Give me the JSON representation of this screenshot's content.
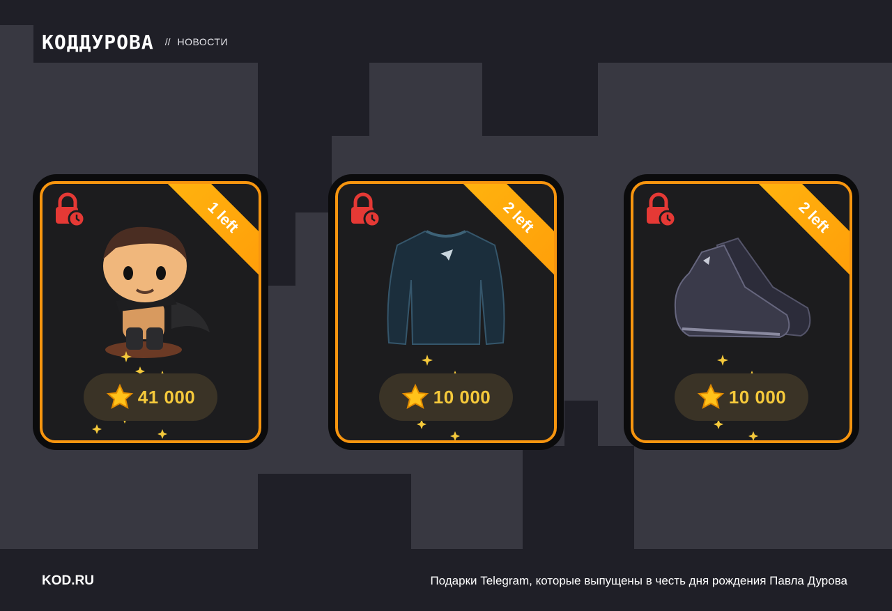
{
  "header": {
    "logo": "КОДДУРОВА",
    "separator": "//",
    "section": "НОВОСТИ"
  },
  "cards": [
    {
      "ribbon": "1 left",
      "price": "41 000",
      "art_icon": "durov-figure-icon"
    },
    {
      "ribbon": "2 left",
      "price": "10 000",
      "art_icon": "telegram-shirt-icon"
    },
    {
      "ribbon": "2 left",
      "price": "10 000",
      "art_icon": "sneakers-icon"
    }
  ],
  "footer": {
    "site": "KOD.RU",
    "caption": "Подарки Telegram, которые выпущены в честь дня рождения Павла Дурова"
  },
  "colors": {
    "accent": "#f7950f",
    "price": "#f5c93b",
    "lock": "#e53935",
    "background": "#1f1f27",
    "block": "#383841"
  }
}
